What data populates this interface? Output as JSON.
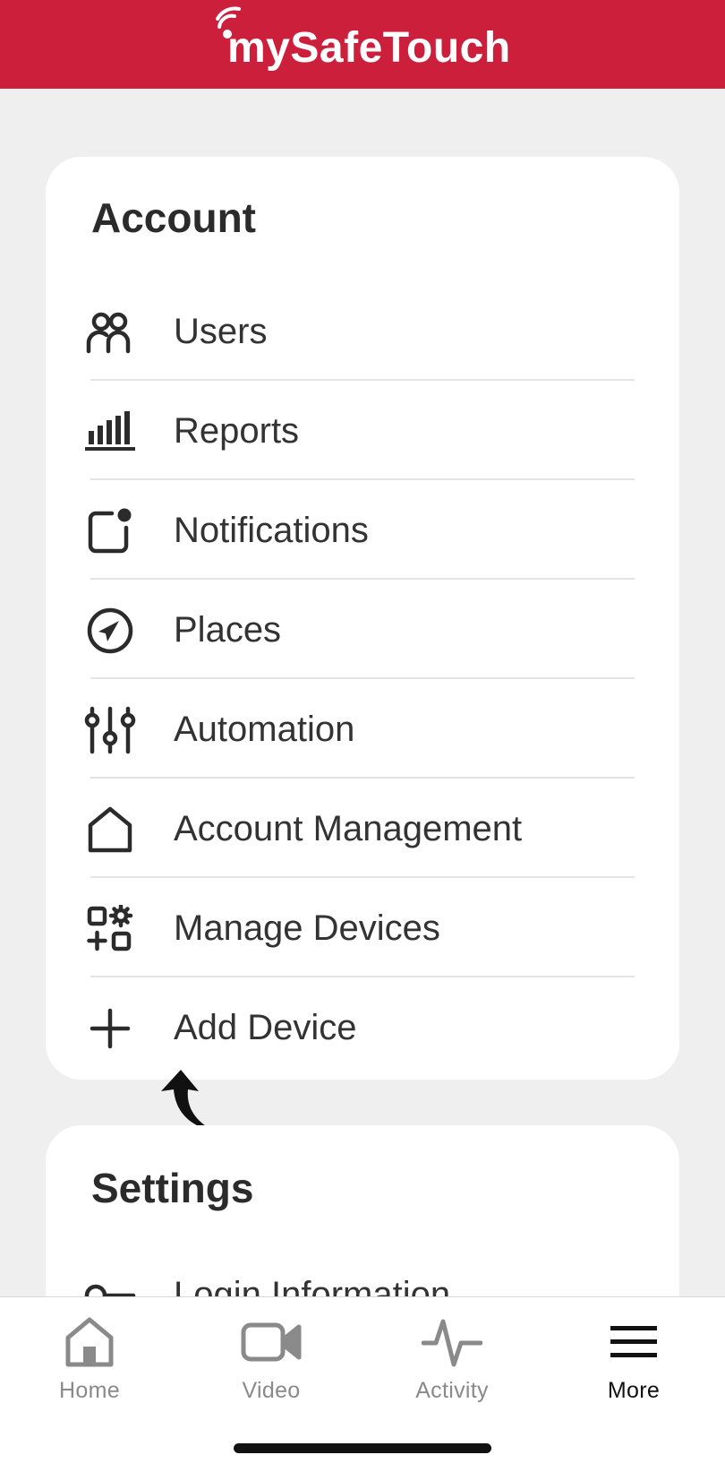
{
  "header": {
    "logo_text": "mySafeTouch",
    "brand_color": "#cc1f3c"
  },
  "account": {
    "title": "Account",
    "items": [
      {
        "label": "Users",
        "icon": "users-icon"
      },
      {
        "label": "Reports",
        "icon": "reports-icon"
      },
      {
        "label": "Notifications",
        "icon": "notifications-icon"
      },
      {
        "label": "Places",
        "icon": "places-icon"
      },
      {
        "label": "Automation",
        "icon": "automation-icon"
      },
      {
        "label": "Account Management",
        "icon": "home-outline-icon"
      },
      {
        "label": "Manage Devices",
        "icon": "manage-devices-icon"
      },
      {
        "label": "Add Device",
        "icon": "plus-icon"
      }
    ]
  },
  "settings": {
    "title": "Settings",
    "items": [
      {
        "label": "Login Information",
        "icon": "key-icon"
      }
    ]
  },
  "tabbar": {
    "tabs": [
      {
        "label": "Home",
        "icon": "home-icon",
        "active": false
      },
      {
        "label": "Video",
        "icon": "video-camera-icon",
        "active": false
      },
      {
        "label": "Activity",
        "icon": "activity-pulse-icon",
        "active": false
      },
      {
        "label": "More",
        "icon": "menu-icon",
        "active": true
      }
    ]
  }
}
